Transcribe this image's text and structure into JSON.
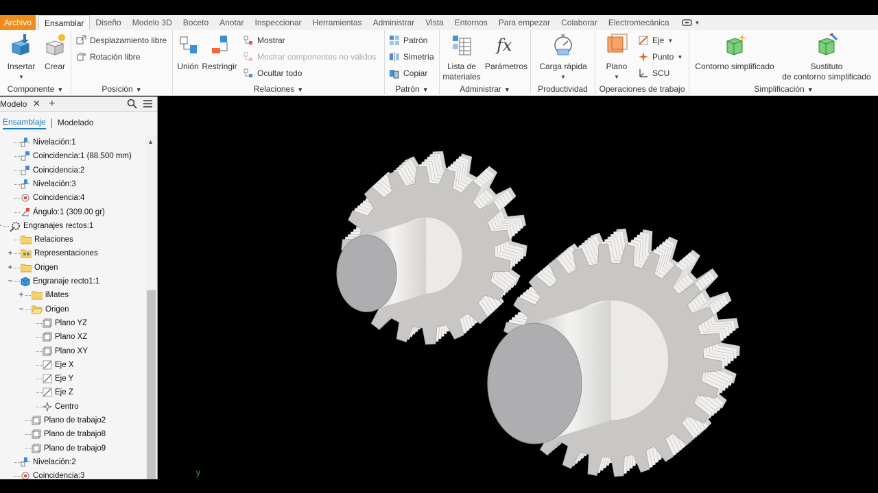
{
  "tabs": [
    {
      "label": "Archivo",
      "type": "file"
    },
    {
      "label": "Ensamblar",
      "type": "active"
    },
    {
      "label": "Diseño"
    },
    {
      "label": "Modelo 3D"
    },
    {
      "label": "Boceto"
    },
    {
      "label": "Anotar"
    },
    {
      "label": "Inspeccionar"
    },
    {
      "label": "Herramientas"
    },
    {
      "label": "Administrar"
    },
    {
      "label": "Vista"
    },
    {
      "label": "Entornos"
    },
    {
      "label": "Para empezar"
    },
    {
      "label": "Colaborar"
    },
    {
      "label": "Electromecánica"
    }
  ],
  "ribbon": {
    "componente": {
      "title": "Componente",
      "insertar": "Insertar",
      "crear": "Crear"
    },
    "posicion": {
      "title": "Posición",
      "desplazamiento": "Desplazamiento libre",
      "rotacion": "Rotación libre"
    },
    "relaciones": {
      "title": "Relaciones",
      "union": "Unión",
      "restringir": "Restringir",
      "mostrar": "Mostrar",
      "mostrar_no_validos": "Mostrar componentes no válidos",
      "ocultar_todo": "Ocultar todo"
    },
    "patron": {
      "title": "Patrón",
      "patron": "Patrón",
      "simetria": "Simetría",
      "copiar": "Copiar"
    },
    "administrar": {
      "title": "Administrar",
      "lista_line1": "Lista de",
      "lista_line2": "materiales",
      "parametros": "Parámetros"
    },
    "productividad": {
      "title": "Productividad",
      "carga": "Carga rápida"
    },
    "operaciones": {
      "title": "Operaciones de trabajo",
      "plano": "Plano",
      "eje": "Eje",
      "punto": "Punto",
      "scu": "SCU"
    },
    "simplificacion": {
      "title": "Simplificación",
      "contorno": "Contorno simplificado",
      "sustituto_line1": "Sustituto",
      "sustituto_line2": "de contorno simplificado"
    }
  },
  "browser": {
    "title": "Modelo",
    "tab_ensamblaje": "Ensamblaje",
    "tab_modelado": "Modelado",
    "tree": [
      {
        "label": "Nivelación:1",
        "icon": "flush-constraint",
        "indent": 2
      },
      {
        "label": "Coincidencia:1 (88.500 mm)",
        "icon": "mate-constraint",
        "indent": 2
      },
      {
        "label": "Coincidencia:2",
        "icon": "mate-constraint",
        "indent": 2
      },
      {
        "label": "Nivelación:3",
        "icon": "flush-constraint",
        "indent": 2
      },
      {
        "label": "Coincidencia:4",
        "icon": "insert-constraint",
        "indent": 2
      },
      {
        "label": "Ángulo:1 (309.00 gr)",
        "icon": "angle-constraint",
        "indent": 2
      },
      {
        "label": "Engranajes rectos:1",
        "icon": "gear-assembly",
        "indent": 1,
        "expander": "−"
      },
      {
        "label": "Relaciones",
        "icon": "folder",
        "indent": 2
      },
      {
        "label": "Representaciones",
        "icon": "representations",
        "indent": 2,
        "expander": "+"
      },
      {
        "label": "Origen",
        "icon": "folder",
        "indent": 2,
        "expander": "+"
      },
      {
        "label": "Engranaje recto1:1",
        "icon": "part",
        "indent": 2,
        "expander": "−"
      },
      {
        "label": "iMates",
        "icon": "folder",
        "indent": 3,
        "expander": "+"
      },
      {
        "label": "Origen",
        "icon": "folder-open",
        "indent": 3,
        "expander": "−"
      },
      {
        "label": "Plano YZ",
        "icon": "plane",
        "indent": 4
      },
      {
        "label": "Plano XZ",
        "icon": "plane",
        "indent": 4
      },
      {
        "label": "Plano XY",
        "icon": "plane",
        "indent": 4
      },
      {
        "label": "Eje X",
        "icon": "axis",
        "indent": 4
      },
      {
        "label": "Eje Y",
        "icon": "axis",
        "indent": 4
      },
      {
        "label": "Eje Z",
        "icon": "axis",
        "indent": 4
      },
      {
        "label": "Centro",
        "icon": "point",
        "indent": 4
      },
      {
        "label": "Plano de trabajo2",
        "icon": "plane",
        "indent": 3
      },
      {
        "label": "Plano de trabajo8",
        "icon": "plane",
        "indent": 3
      },
      {
        "label": "Plano de trabajo9",
        "icon": "plane",
        "indent": 3
      },
      {
        "label": "Nivelación:2",
        "icon": "flush-constraint",
        "indent": 2
      },
      {
        "label": "Coincidencia:3",
        "icon": "insert-constraint",
        "indent": 2
      }
    ]
  },
  "viewport": {
    "axis_label": "y"
  },
  "colors": {
    "file_tab": "#f08c1a",
    "accent": "#1a7bbd",
    "viewport_bg": "#000000",
    "gear_face": "#c8c7c5",
    "axis_y": "#3dbb3d"
  }
}
